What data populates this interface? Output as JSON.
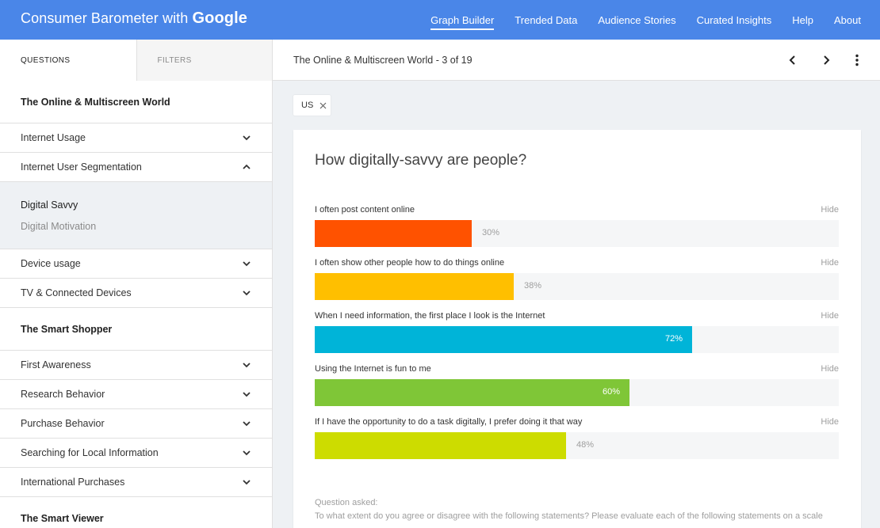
{
  "header": {
    "brand_prefix": "Consumer Barometer with",
    "brand_google": "Google",
    "nav": [
      "Graph Builder",
      "Trended Data",
      "Audience Stories",
      "Curated Insights",
      "Help",
      "About"
    ],
    "active_nav": "Graph Builder",
    "background_color": "#4a86e8"
  },
  "sidebar": {
    "tabs": [
      {
        "label": "QUESTIONS",
        "active": true
      },
      {
        "label": "FILTERS",
        "active": false
      }
    ],
    "section1": {
      "title": "The Online & Multiscreen World",
      "items": [
        {
          "label": "Internet Usage",
          "icon": "chevron-down-icon"
        },
        {
          "label": "Internet User Segmentation",
          "icon": "chevron-up-icon"
        }
      ],
      "subitems": [
        {
          "label": "Digital Savvy",
          "active": true
        },
        {
          "label": "Digital Motivation",
          "active": false
        }
      ],
      "items_after": [
        {
          "label": "Device usage",
          "icon": "chevron-down-icon"
        },
        {
          "label": "TV & Connected Devices",
          "icon": "chevron-down-icon"
        }
      ]
    },
    "section2": {
      "title": "The Smart Shopper",
      "items": [
        {
          "label": "First Awareness",
          "icon": "chevron-down-icon"
        },
        {
          "label": "Research Behavior",
          "icon": "chevron-down-icon"
        },
        {
          "label": "Purchase Behavior",
          "icon": "chevron-down-icon"
        },
        {
          "label": "Searching for Local Information",
          "icon": "chevron-down-icon"
        },
        {
          "label": "International Purchases",
          "icon": "chevron-down-icon"
        }
      ]
    },
    "section3": {
      "title": "The Smart Viewer"
    }
  },
  "toolbar": {
    "title": "The Online & Multiscreen World - 3 of 19",
    "icons": [
      "chevron-left-icon",
      "chevron-right-icon",
      "more-vert-icon"
    ]
  },
  "filter_chip": {
    "label": "US",
    "icon": "close-icon"
  },
  "card": {
    "title": "How digitally-savvy are people?",
    "hide_label": "Hide",
    "question_label": "Question asked:",
    "question_text": "To what extent do you agree or disagree with the following statements? Please evaluate each of the following statements on a scale"
  },
  "chart_data": {
    "type": "bar",
    "orientation": "horizontal",
    "categories": [
      "I often post content online",
      "I often show other people how to do things online",
      "When I need information, the first place I look is the Internet",
      "Using the Internet is fun to me",
      "If I have the opportunity to do a task digitally, I prefer doing it that way"
    ],
    "values": [
      30,
      38,
      72,
      60,
      48
    ],
    "labels": [
      "30%",
      "38%",
      "72%",
      "60%",
      "48%"
    ],
    "colors": [
      "#ff5200",
      "#ffbf00",
      "#00b4d8",
      "#7fc637",
      "#cddc00"
    ],
    "xlim": [
      0,
      100
    ]
  }
}
